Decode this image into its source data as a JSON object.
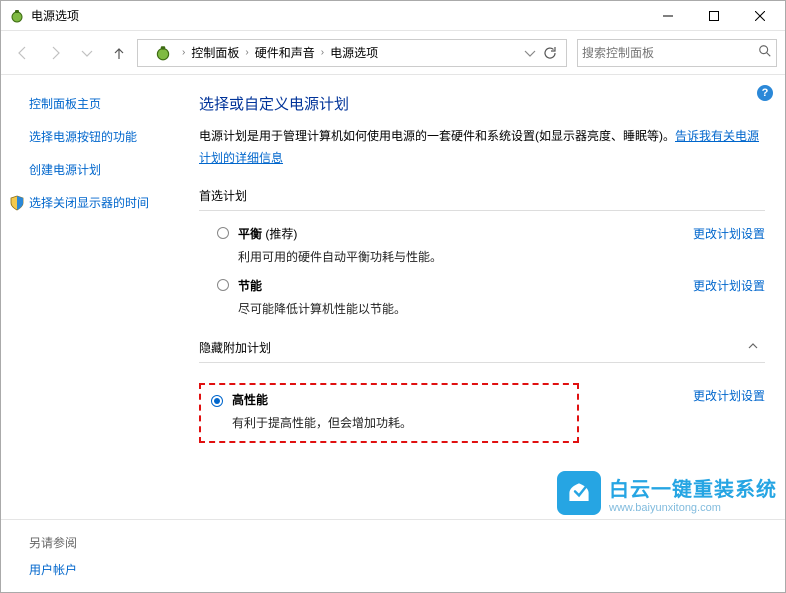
{
  "window": {
    "title": "电源选项"
  },
  "nav": {
    "breadcrumb": [
      "控制面板",
      "硬件和声音",
      "电源选项"
    ],
    "search_placeholder": "搜索控制面板"
  },
  "sidebar": {
    "items": [
      {
        "label": "控制面板主页",
        "icon": false
      },
      {
        "label": "选择电源按钮的功能",
        "icon": false
      },
      {
        "label": "创建电源计划",
        "icon": false
      },
      {
        "label": "选择关闭显示器的时间",
        "icon": true
      }
    ]
  },
  "main": {
    "title": "选择或自定义电源计划",
    "desc_pre": "电源计划是用于管理计算机如何使用电源的一套硬件和系统设置(如显示器亮度、睡眠等)。",
    "desc_link": "告诉我有关电源计划的详细信息",
    "preferred_label": "首选计划",
    "hidden_label": "隐藏附加计划",
    "change_link": "更改计划设置",
    "plans": {
      "preferred": [
        {
          "name_prefix": "平衡",
          "name_suffix": " (推荐)",
          "desc": "利用可用的硬件自动平衡功耗与性能。",
          "checked": false
        },
        {
          "name_prefix": "节能",
          "name_suffix": "",
          "desc": "尽可能降低计算机性能以节能。",
          "checked": false
        }
      ],
      "hidden": [
        {
          "name_prefix": "高性能",
          "name_suffix": "",
          "desc": "有利于提高性能，但会增加功耗。",
          "checked": true
        }
      ]
    }
  },
  "footer": {
    "see_also": "另请参阅",
    "link": "用户帐户"
  },
  "watermark": {
    "title": "白云一键重装系统",
    "url": "www.baiyunxitong.com"
  }
}
